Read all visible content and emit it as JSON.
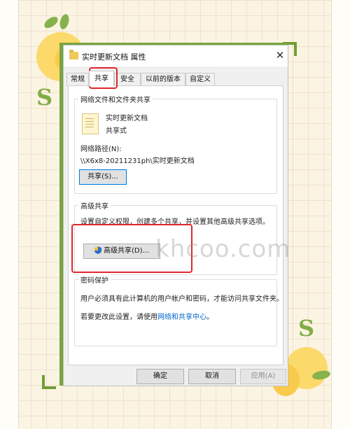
{
  "window": {
    "title": "实时更新文档 属性",
    "close_glyph": "✕"
  },
  "tabs": [
    {
      "label": "常规",
      "active": false
    },
    {
      "label": "共享",
      "active": true
    },
    {
      "label": "安全",
      "active": false
    },
    {
      "label": "以前的版本",
      "active": false
    },
    {
      "label": "自定义",
      "active": false
    }
  ],
  "network_sharing": {
    "group_title": "网络文件和文件夹共享",
    "item_name": "实时更新文档",
    "item_status": "共享式",
    "path_label": "网络路径(N):",
    "path_value": "\\\\X6x8-20211231ph\\实时更新文档",
    "share_button": "共享(S)..."
  },
  "advanced_sharing": {
    "group_title": "高级共享",
    "description": "设置自定义权限，创建多个共享，并设置其他高级共享选项。",
    "button": "高级共享(D)..."
  },
  "password_protection": {
    "group_title": "密码保护",
    "line1": "用户必须具有此计算机的用户帐户和密码，才能访问共享文件夹。",
    "line2_prefix": "若要更改此设置，请使用",
    "line2_link": "网络和共享中心",
    "line2_suffix": "。"
  },
  "footer": {
    "ok": "确定",
    "cancel": "取消",
    "apply": "应用(A)"
  },
  "watermark": "khcoo.com",
  "decorations": {
    "s_glyph": "S"
  },
  "colors": {
    "highlight_red": "#e0262d",
    "focus_blue": "#0078d7",
    "link_blue": "#0066cc",
    "deco_green": "#77a53d",
    "deco_yellow": "#fbd96a"
  },
  "icons": [
    "folder-icon",
    "close-icon",
    "document-icon",
    "uac-shield-icon"
  ]
}
